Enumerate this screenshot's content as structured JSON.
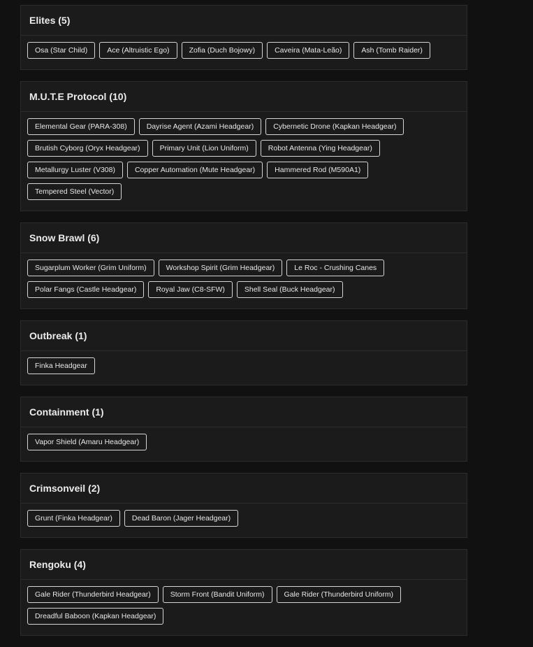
{
  "sections": [
    {
      "title": "Elites (5)",
      "items": [
        "Osa (Star Child)",
        "Ace (Altruistic Ego)",
        "Zofia (Duch Bojowy)",
        "Caveira (Mata-Leão)",
        "Ash (Tomb Raider)"
      ]
    },
    {
      "title": "M.U.T.E Protocol (10)",
      "items": [
        "Elemental Gear (PARA-308)",
        "Dayrise Agent (Azami Headgear)",
        "Cybernetic Drone (Kapkan Headgear)",
        "Brutish Cyborg (Oryx Headgear)",
        "Primary Unit (Lion Uniform)",
        "Robot Antenna (Ying Headgear)",
        "Metallurgy Luster (V308)",
        "Copper Automation (Mute Headgear)",
        "Hammered Rod (M590A1)",
        "Tempered Steel (Vector)"
      ]
    },
    {
      "title": "Snow Brawl (6)",
      "items": [
        "Sugarplum Worker (Grim Uniform)",
        "Workshop Spirit (Grim Headgear)",
        "Le Roc - Crushing Canes",
        "Polar Fangs (Castle Headgear)",
        "Royal Jaw (C8-SFW)",
        "Shell Seal (Buck Headgear)"
      ]
    },
    {
      "title": "Outbreak (1)",
      "items": [
        "Finka Headgear"
      ]
    },
    {
      "title": "Containment (1)",
      "items": [
        "Vapor Shield (Amaru Headgear)"
      ]
    },
    {
      "title": "Crimsonveil (2)",
      "items": [
        "Grunt (Finka Headgear)",
        "Dead Baron (Jager Headgear)"
      ]
    },
    {
      "title": "Rengoku (4)",
      "items": [
        "Gale Rider (Thunderbird Headgear)",
        "Storm Front (Bandit Uniform)",
        "Gale Rider (Thunderbird Uniform)",
        "Dreadful Baboon (Kapkan Headgear)"
      ]
    }
  ]
}
